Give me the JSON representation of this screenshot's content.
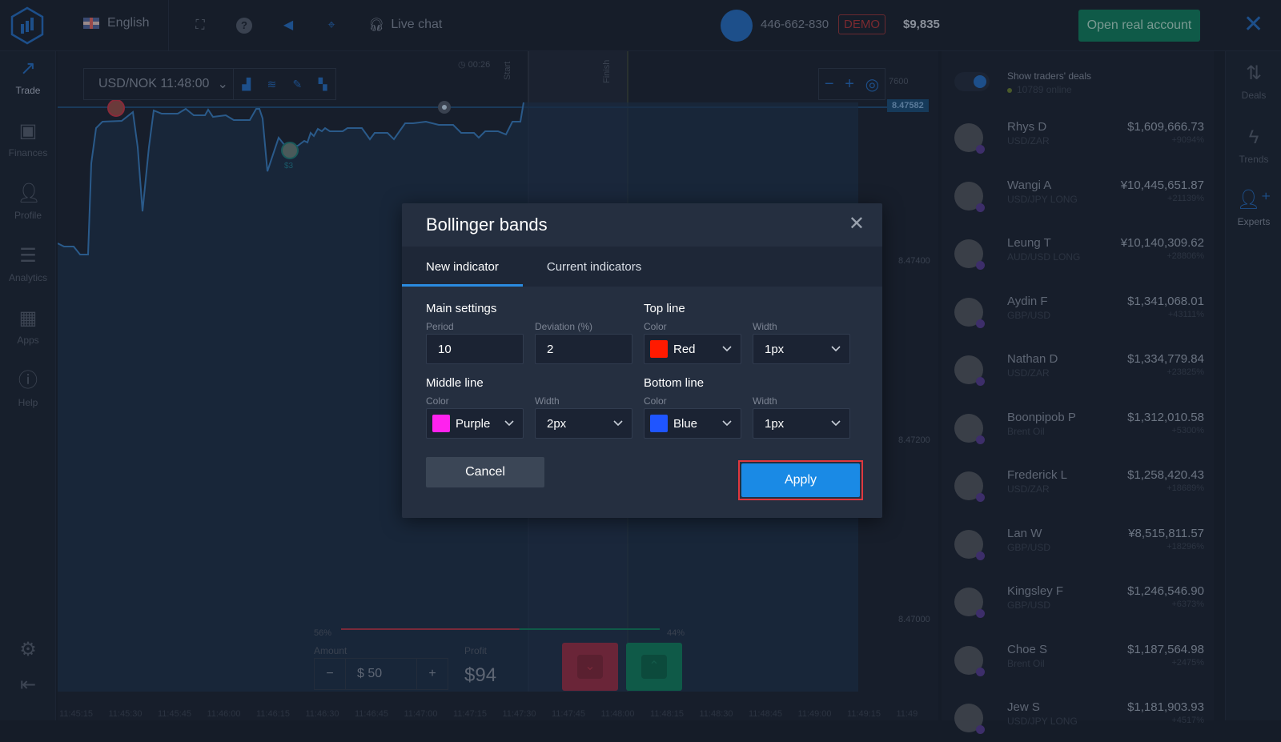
{
  "topbar": {
    "language": "English",
    "live_chat": "Live chat",
    "account_number": "446-662-830",
    "account_mode": "DEMO",
    "balance": "$9,835",
    "open_real_account": "Open real account"
  },
  "left_nav": [
    {
      "label": "Trade",
      "icon": "trend-up-icon",
      "active": true
    },
    {
      "label": "Finances",
      "icon": "banknote-icon"
    },
    {
      "label": "Profile",
      "icon": "user-icon"
    },
    {
      "label": "Analytics",
      "icon": "document-icon"
    },
    {
      "label": "Apps",
      "icon": "grid-icon"
    },
    {
      "label": "Help",
      "icon": "info-icon"
    }
  ],
  "right_nav": [
    {
      "label": "Deals",
      "icon": "up-down-arrows-icon"
    },
    {
      "label": "Trends",
      "icon": "lightning-icon"
    },
    {
      "label": "Experts",
      "icon": "add-user-icon",
      "active": true
    }
  ],
  "chart": {
    "asset": "USD/NOK 11:48:00",
    "timer": "00:26",
    "start_label": "Start",
    "finish_label": "Finish",
    "current_price": "8.47582",
    "y_ticks": [
      "7600",
      "8.47400",
      "8.47200",
      "8.47000"
    ],
    "x_ticks": [
      "11:45:15",
      "11:45:30",
      "11:45:45",
      "11:46:00",
      "11:46:15",
      "11:46:30",
      "11:46:45",
      "11:47:00",
      "11:47:15",
      "11:47:30",
      "11:47:45",
      "11:48:00",
      "11:48:15",
      "11:48:30",
      "11:48:45",
      "11:49:00",
      "11:49:15",
      "11:49"
    ],
    "trade_marker_label": "$3",
    "down_pct": "56%",
    "up_pct": "44%",
    "down_fraction": 0.56
  },
  "trade_panel": {
    "amount_label": "Amount",
    "amount_value": "$ 50",
    "minus": "−",
    "plus": "+",
    "profit_label": "Profit",
    "profit_value": "$94"
  },
  "traders_panel": {
    "show_deals": "Show traders' deals",
    "online": "10789 online",
    "traders": [
      {
        "name": "Rhys D",
        "pair": "USD/ZAR",
        "profit": "$1,609,666.73",
        "pct": "+9094%"
      },
      {
        "name": "Wangi A",
        "pair": "USD/JPY LONG",
        "profit": "¥10,445,651.87",
        "pct": "+21139%"
      },
      {
        "name": "Leung T",
        "pair": "AUD/USD LONG",
        "profit": "¥10,140,309.62",
        "pct": "+28806%"
      },
      {
        "name": "Aydin F",
        "pair": "GBP/USD",
        "profit": "$1,341,068.01",
        "pct": "+43111%"
      },
      {
        "name": "Nathan D",
        "pair": "USD/ZAR",
        "profit": "$1,334,779.84",
        "pct": "+23825%"
      },
      {
        "name": "Boonpipob P",
        "pair": "Brent Oil",
        "profit": "$1,312,010.58",
        "pct": "+5300%"
      },
      {
        "name": "Frederick L",
        "pair": "USD/ZAR",
        "profit": "$1,258,420.43",
        "pct": "+18689%"
      },
      {
        "name": "Lan W",
        "pair": "GBP/USD",
        "profit": "¥8,515,811.57",
        "pct": "+18296%"
      },
      {
        "name": "Kingsley F",
        "pair": "GBP/USD",
        "profit": "$1,246,546.90",
        "pct": "+6373%"
      },
      {
        "name": "Choe S",
        "pair": "Brent Oil",
        "profit": "$1,187,564.98",
        "pct": "+2475%"
      },
      {
        "name": "Jew S",
        "pair": "USD/JPY LONG",
        "profit": "$1,181,903.93",
        "pct": "+4517%"
      }
    ]
  },
  "modal": {
    "title": "Bollinger bands",
    "tabs": [
      {
        "label": "New indicator",
        "active": true
      },
      {
        "label": "Current indicators"
      }
    ],
    "main_settings": {
      "heading": "Main settings",
      "period_label": "Period",
      "period_value": "10",
      "deviation_label": "Deviation (%)",
      "deviation_value": "2"
    },
    "top_line": {
      "heading": "Top line",
      "color_label": "Color",
      "color_name": "Red",
      "color_hex": "#ff1a00",
      "width_label": "Width",
      "width_value": "1px"
    },
    "middle_line": {
      "heading": "Middle line",
      "color_label": "Color",
      "color_name": "Purple",
      "color_hex": "#ff22ee",
      "width_label": "Width",
      "width_value": "2px"
    },
    "bottom_line": {
      "heading": "Bottom line",
      "color_label": "Color",
      "color_name": "Blue",
      "color_hex": "#1f55ff",
      "width_label": "Width",
      "width_value": "1px"
    },
    "cancel": "Cancel",
    "apply": "Apply"
  }
}
